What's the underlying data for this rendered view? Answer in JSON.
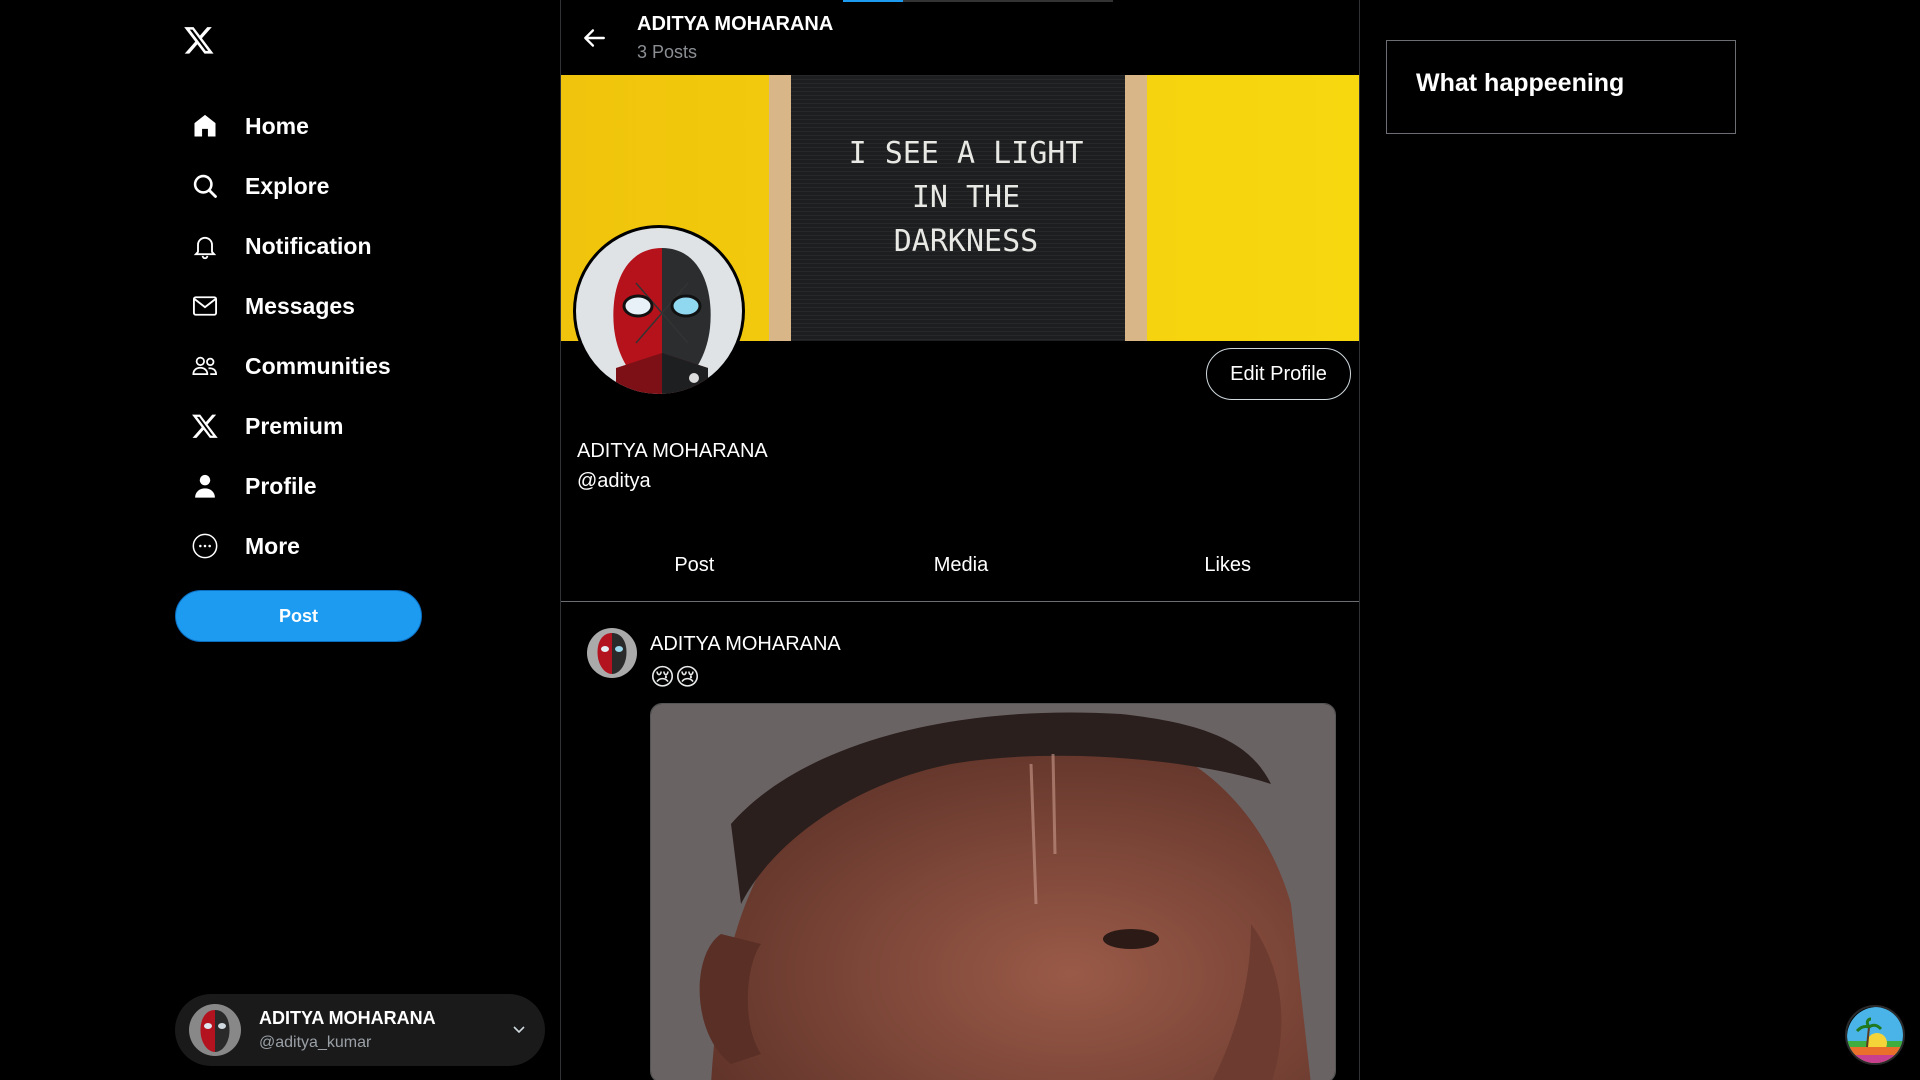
{
  "sidebar": {
    "logo_icon": "x-logo-icon",
    "nav": [
      {
        "label": "Home",
        "icon": "home-icon"
      },
      {
        "label": "Explore",
        "icon": "search-icon"
      },
      {
        "label": "Notification",
        "icon": "bell-icon"
      },
      {
        "label": "Messages",
        "icon": "mail-icon"
      },
      {
        "label": "Communities",
        "icon": "people-icon"
      },
      {
        "label": "Premium",
        "icon": "x-logo-icon"
      },
      {
        "label": "Profile",
        "icon": "person-icon"
      },
      {
        "label": "More",
        "icon": "more-circle-icon"
      }
    ],
    "post_button": "Post",
    "account": {
      "name": "ADITYA MOHARANA",
      "handle": "@aditya_kumar"
    }
  },
  "header": {
    "title": "ADITYA MOHARANA",
    "post_count": "3 Posts"
  },
  "banner": {
    "lines": [
      "I SEE A LIGHT",
      "IN THE",
      "DARKNESS"
    ]
  },
  "profile": {
    "edit_button": "Edit Profile",
    "name": "ADITYA MOHARANA",
    "handle": "@aditya"
  },
  "tabs": [
    "Post",
    "Media",
    "Likes"
  ],
  "post": {
    "author": "ADITYA MOHARANA",
    "text": "😢😢"
  },
  "right": {
    "trends_title": "What happeening"
  },
  "colors": {
    "accent": "#1d9bf0",
    "banner_yellow": "#f3cc0f",
    "background": "#000000"
  }
}
